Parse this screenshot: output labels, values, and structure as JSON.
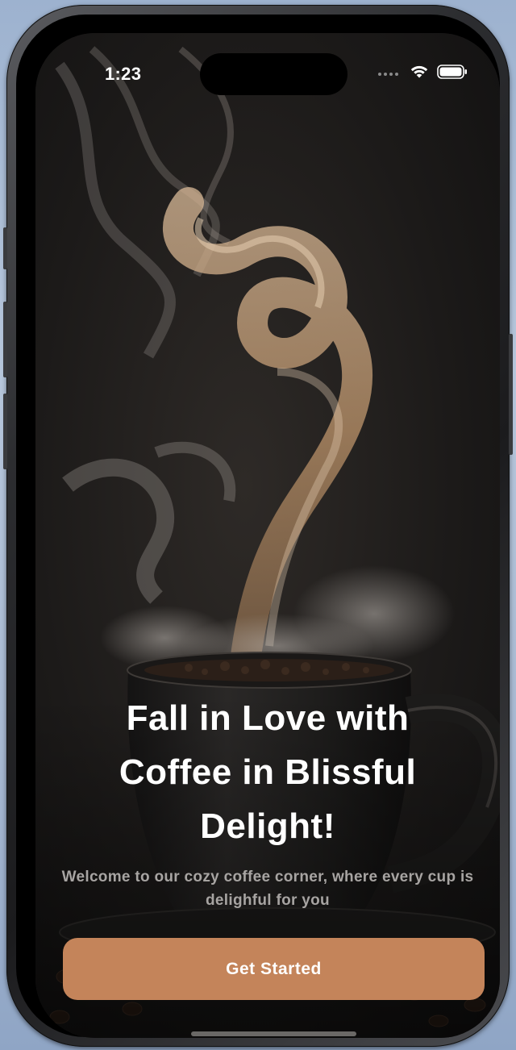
{
  "status_bar": {
    "time": "1:23",
    "icons": [
      "cellular-signal-icon",
      "wifi-icon",
      "battery-icon"
    ]
  },
  "onboarding": {
    "headline": "Fall in Love with Coffee in Blissful Delight!",
    "subtitle": "Welcome to our cozy coffee corner, where every cup is delighful for you",
    "cta_label": "Get Started"
  },
  "colors": {
    "accent": "#c4845a",
    "background": "#1a1818",
    "headline_text": "#ffffff",
    "subtitle_text": "#a7a4a2"
  }
}
